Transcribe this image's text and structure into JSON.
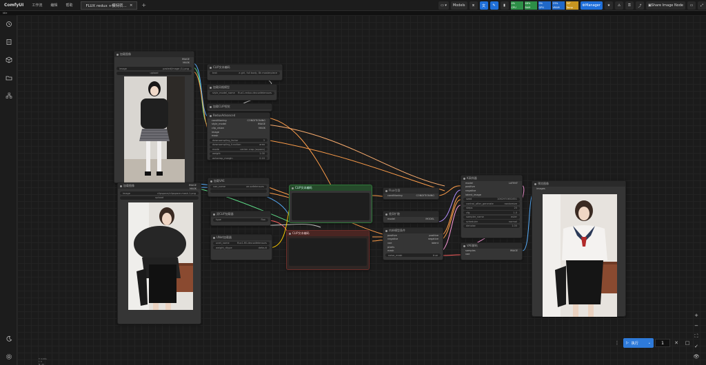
{
  "app": {
    "logo": "ComfyUI",
    "menu": [
      "工作流",
      "编辑",
      "帮助"
    ],
    "tab_title": "FLUX redux +模特转...",
    "tab_close": "×",
    "tab_add": "+"
  },
  "topbar": {
    "queue_label": "▭ ▾",
    "models_label": "Models",
    "manager_label": "Manager",
    "share_label": "Share Image Node",
    "monitors": [
      {
        "label": "CPU",
        "value": "4%",
        "color": "#2e9a4a",
        "level": 0.04
      },
      {
        "label": "RAM",
        "value": "48%",
        "color": "#2e9a4a",
        "level": 0.48
      },
      {
        "label": "GPU",
        "value": "0%",
        "color": "#1f6fd9",
        "level": 0.0
      },
      {
        "label": "VRAM",
        "value": "23%",
        "color": "#1f6fd9",
        "level": 0.23
      },
      {
        "label": "Temp",
        "value": "34°",
        "color": "#d9a21f",
        "level": 0.34
      }
    ]
  },
  "subbar": {
    "label": "Idle"
  },
  "sidebar": {
    "icons": [
      "history-icon",
      "queue-icon",
      "node-library-icon",
      "model-library-icon",
      "workflows-icon",
      "theme-icon",
      "settings-icon"
    ]
  },
  "nodes": {
    "load_image_1": {
      "title": "加载图像",
      "outputs": [
        "IMAGE",
        "MASK"
      ],
      "widgets": [
        {
          "label": "image",
          "value": "pasted/image (1).png"
        },
        {
          "label": "",
          "value": "upload"
        }
      ]
    },
    "clip_text": {
      "title": "CLIP文本编码",
      "widgets": [
        {
          "label": "text",
          "value": "a girl, full body, 8k masterpiece"
        }
      ]
    },
    "style_model": {
      "title": "加载风格模型",
      "widgets": [
        {
          "label": "style_model_name",
          "value": "flux1-redux-dev.safetensors"
        }
      ]
    },
    "clip_vision_loader": {
      "title": "加载CLIP视觉",
      "widgets": [
        {
          "label": "clip_name",
          "value": "sigclip_vision_patch14_384.safetensors"
        }
      ]
    },
    "redux_advanced": {
      "title": "ReduxAdvanced",
      "inputs": [
        "conditioning",
        "style_model",
        "clip_vision",
        "image",
        "mask"
      ],
      "outputs": [
        "CONDITIONING",
        "IMAGE",
        "MASK"
      ],
      "widgets": [
        {
          "label": "downsampling_factor",
          "value": "3"
        },
        {
          "label": "downsampling_function",
          "value": "area"
        },
        {
          "label": "mode",
          "value": "center crop (square)"
        },
        {
          "label": "weight",
          "value": "1.00"
        },
        {
          "label": "autocrop_margin",
          "value": "0.10"
        }
      ]
    },
    "load_image_2": {
      "title": "加载图像",
      "outputs": [
        "IMAGE",
        "MASK"
      ],
      "widgets": [
        {
          "label": "image",
          "value": "clipspace/clipspace-mask-1.png"
        },
        {
          "label": "",
          "value": "upload"
        }
      ]
    },
    "vae_loader": {
      "title": "加载VAE",
      "widgets": [
        {
          "label": "vae_name",
          "value": "ae.safetensors"
        }
      ]
    },
    "dual_clip": {
      "title": "双CLIP加载器",
      "widgets": [
        {
          "label": "clip_name1",
          "value": "clip_l.safetensors"
        },
        {
          "label": "clip_name2",
          "value": "t5xxl_fp16.safetensors"
        },
        {
          "label": "type",
          "value": "flux"
        }
      ]
    },
    "unet_loader": {
      "title": "UNet加载器",
      "widgets": [
        {
          "label": "unet_name",
          "value": "flux1-fill-dev.safetensors"
        },
        {
          "label": "weight_dtype",
          "value": "default"
        }
      ]
    },
    "clip_encode_pos": {
      "title": "CLIP文本编码"
    },
    "clip_encode_neg": {
      "title": "CLIP文本编码"
    },
    "flux_guidance": {
      "title": "Flux引导",
      "inputs": [
        "conditioning"
      ],
      "outputs": [
        "CONDITIONING"
      ],
      "widgets": [
        {
          "label": "guidance",
          "value": "30.0"
        }
      ]
    },
    "differential_diffusion": {
      "title": "差异扩散",
      "inputs": [
        "model"
      ],
      "outputs": [
        "MODEL"
      ]
    },
    "inpaint_conditioning": {
      "title": "内补模型条件",
      "inputs": [
        "positive",
        "negative",
        "vae",
        "pixels",
        "mask"
      ],
      "outputs": [
        "positive",
        "negative",
        "latent"
      ],
      "widgets": [
        {
          "label": "noise_mask",
          "value": "true"
        }
      ]
    },
    "ksampler": {
      "title": "K采样器",
      "inputs": [
        "model",
        "positive",
        "negative",
        "latent_image"
      ],
      "outputs": [
        "LATENT"
      ],
      "widgets": [
        {
          "label": "seed",
          "value": "1062970652851"
        },
        {
          "label": "control_after_generate",
          "value": "randomize"
        },
        {
          "label": "steps",
          "value": "20"
        },
        {
          "label": "cfg",
          "value": "1.0"
        },
        {
          "label": "sampler_name",
          "value": "euler"
        },
        {
          "label": "scheduler",
          "value": "normal"
        },
        {
          "label": "denoise",
          "value": "1.00"
        }
      ]
    },
    "vae_decode": {
      "title": "VAE解码",
      "inputs": [
        "samples",
        "vae"
      ],
      "outputs": [
        "IMAGE"
      ]
    },
    "preview": {
      "title": "预览图像",
      "inputs": [
        "images"
      ]
    }
  },
  "bottom": {
    "run_label": "执行",
    "batch_count": "1"
  },
  "zoom_controls": [
    "+",
    "−",
    "⛶",
    "✓",
    "👁"
  ],
  "stats": [
    "T: 0.00s",
    "I: 0",
    "N: 22",
    "V: 47",
    "FPS: 60"
  ]
}
